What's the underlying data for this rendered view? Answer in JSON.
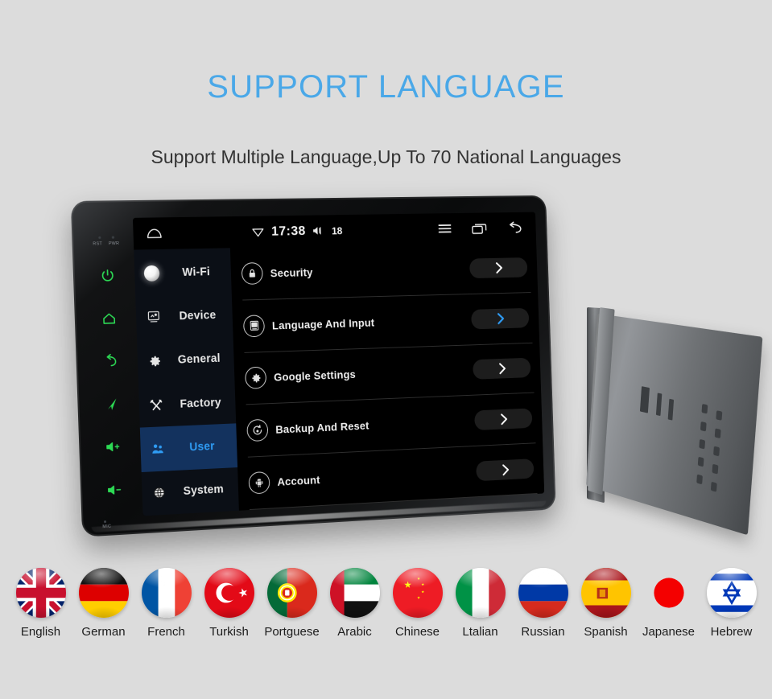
{
  "page": {
    "title": "SUPPORT LANGUAGE",
    "subtitle": "Support Multiple Language,Up To 70 National Languages",
    "title_color": "#4aa8e8",
    "background_color": "#dcdcdc"
  },
  "device": {
    "bezel": {
      "sensor_labels": [
        "RST",
        "PWR"
      ],
      "mic_label": "MIC",
      "buttons": [
        {
          "name": "power",
          "icon": "power-icon",
          "color": "#2ddb55"
        },
        {
          "name": "home",
          "icon": "home-icon",
          "color": "#2ddb55"
        },
        {
          "name": "back",
          "icon": "back-arrow-icon",
          "color": "#2ddb55"
        },
        {
          "name": "navigation",
          "icon": "navigation-arrow-icon",
          "color": "#2ddb55"
        },
        {
          "name": "volume-up",
          "icon": "volume-up-icon",
          "color": "#2ddb55"
        },
        {
          "name": "volume-down",
          "icon": "volume-down-icon",
          "color": "#2ddb55"
        }
      ]
    },
    "status_bar": {
      "home_icon": "android-home-icon",
      "wifi_icon": "wifi-icon",
      "clock": "17:38",
      "volume_icon": "speaker-icon",
      "volume_value": "18",
      "menu_icon": "hamburger-menu-icon",
      "recents_icon": "recent-apps-icon",
      "back_icon": "back-arrow-icon"
    },
    "sidebar": {
      "items": [
        {
          "label": "Wi-Fi",
          "icon": "wifi-orb-icon",
          "active": false
        },
        {
          "label": "Device",
          "icon": "device-icon",
          "active": false
        },
        {
          "label": "General",
          "icon": "gear-icon",
          "active": false
        },
        {
          "label": "Factory",
          "icon": "tools-icon",
          "active": false
        },
        {
          "label": "User",
          "icon": "user-group-icon",
          "active": true
        },
        {
          "label": "System",
          "icon": "globe-icon",
          "active": false
        }
      ],
      "active_color": "#2f9cf4",
      "active_bg": "#13325e"
    },
    "settings_list": {
      "rows": [
        {
          "label": "Security",
          "icon": "lock-icon",
          "chevron_color": "#ffffff",
          "selected": false
        },
        {
          "label": "Language And Input",
          "icon": "keyboard-icon",
          "chevron_color": "#2f9cf4",
          "selected": true
        },
        {
          "label": "Google Settings",
          "icon": "gear-icon",
          "chevron_color": "#ffffff",
          "selected": false
        },
        {
          "label": "Backup And Reset",
          "icon": "reset-icon",
          "chevron_color": "#ffffff",
          "selected": false
        },
        {
          "label": "Account",
          "icon": "android-robot-icon",
          "chevron_color": "#ffffff",
          "selected": false
        }
      ]
    }
  },
  "flags": [
    {
      "label": "English",
      "code": "gb"
    },
    {
      "label": "German",
      "code": "de"
    },
    {
      "label": "French",
      "code": "fr"
    },
    {
      "label": "Turkish",
      "code": "tr"
    },
    {
      "label": "Portguese",
      "code": "pt"
    },
    {
      "label": "Arabic",
      "code": "ae"
    },
    {
      "label": "Chinese",
      "code": "cn"
    },
    {
      "label": "Ltalian",
      "code": "it"
    },
    {
      "label": "Russian",
      "code": "ru"
    },
    {
      "label": "Spanish",
      "code": "es"
    },
    {
      "label": "Japanese",
      "code": "jp"
    },
    {
      "label": "Hebrew",
      "code": "il"
    }
  ]
}
